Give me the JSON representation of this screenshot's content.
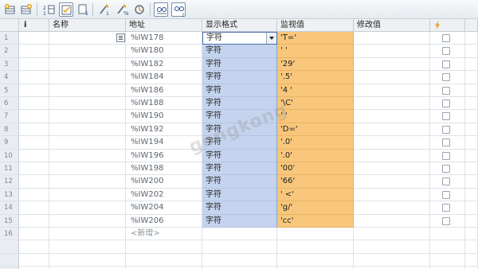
{
  "columns": {
    "info": "i",
    "name": "名称",
    "address": "地址",
    "display_format": "显示格式",
    "monitor_value": "监视值",
    "modify_value": "修改值"
  },
  "rows": [
    {
      "num": "1",
      "address": "%IW178",
      "format": "字符",
      "monitor": "'T='"
    },
    {
      "num": "2",
      "address": "%IW180",
      "format": "字符",
      "monitor": "' '"
    },
    {
      "num": "3",
      "address": "%IW182",
      "format": "字符",
      "monitor": "'29'"
    },
    {
      "num": "4",
      "address": "%IW184",
      "format": "字符",
      "monitor": "'.5'"
    },
    {
      "num": "5",
      "address": "%IW186",
      "format": "字符",
      "monitor": "'4 '"
    },
    {
      "num": "6",
      "address": "%IW188",
      "format": "字符",
      "monitor": "'\\C'"
    },
    {
      "num": "7",
      "address": "%IW190",
      "format": "字符",
      "monitor": "' '"
    },
    {
      "num": "8",
      "address": "%IW192",
      "format": "字符",
      "monitor": "'D='"
    },
    {
      "num": "9",
      "address": "%IW194",
      "format": "字符",
      "monitor": "'.0'"
    },
    {
      "num": "10",
      "address": "%IW196",
      "format": "字符",
      "monitor": "'.0'"
    },
    {
      "num": "11",
      "address": "%IW198",
      "format": "字符",
      "monitor": "'00'"
    },
    {
      "num": "12",
      "address": "%IW200",
      "format": "字符",
      "monitor": "'66'"
    },
    {
      "num": "13",
      "address": "%IW202",
      "format": "字符",
      "monitor": "' <'"
    },
    {
      "num": "14",
      "address": "%IW204",
      "format": "字符",
      "monitor": "'g/'"
    },
    {
      "num": "15",
      "address": "%IW206",
      "format": "字符",
      "monitor": "'cc'"
    }
  ],
  "new_row": {
    "num": "16",
    "placeholder": "<新增>"
  },
  "toolbar_icons": [
    "insert-row-icon",
    "add-row-icon",
    "sort-icon",
    "monitor-toggle-icon",
    "monitor-once-icon",
    "modify-now-icon",
    "force-icon",
    "modify-trigger-icon",
    "show-hide-icon",
    "show-modify-columns-icon"
  ],
  "watermark": "gongkong"
}
